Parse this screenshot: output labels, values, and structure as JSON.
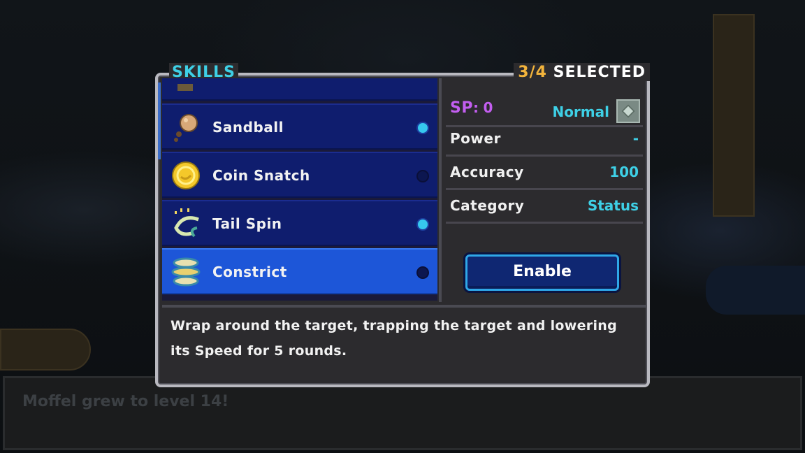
{
  "background": {
    "message": "Moffel grew to level 14!"
  },
  "panel": {
    "title": "SKILLS",
    "count": "3/4",
    "count_label": "SELECTED"
  },
  "skills": [
    {
      "name": "Sandball",
      "enabled": true,
      "icon": "sandball-icon"
    },
    {
      "name": "Coin Snatch",
      "enabled": false,
      "icon": "coin-icon"
    },
    {
      "name": "Tail Spin",
      "enabled": true,
      "icon": "tail-spin-icon"
    },
    {
      "name": "Constrict",
      "enabled": false,
      "icon": "constrict-icon",
      "selected": true
    }
  ],
  "info": {
    "sp_label": "SP",
    "sp_sep": ":",
    "sp_value": "0",
    "type": "Normal",
    "rows": [
      {
        "label": "Power",
        "value": "-"
      },
      {
        "label": "Accuracy",
        "value": "100"
      },
      {
        "label": "Category",
        "value": "Status"
      }
    ],
    "button": "Enable"
  },
  "description": "Wrap around the target, trapping the target and lowering its Speed for 5 rounds.",
  "colors": {
    "accent_cyan": "#3ed0e6",
    "sp_purple": "#c35ef0",
    "count_gold": "#f3b43c",
    "row_blue": "#0f1d6e",
    "selected_blue": "#1d56d8"
  }
}
